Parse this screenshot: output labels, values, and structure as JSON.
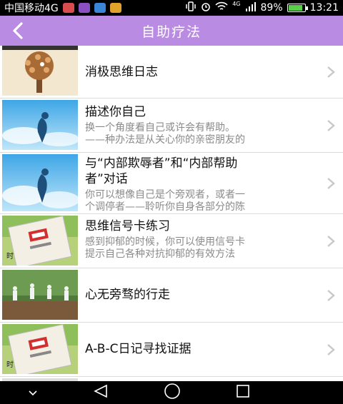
{
  "status_bar": {
    "carrier": "中国移动4G",
    "network_small": "4G",
    "battery_percent": "89%",
    "battery_level": 0.89,
    "time": "13:21"
  },
  "header": {
    "title": "自助疗法",
    "color": "#b98be3"
  },
  "list": [
    {
      "title": "消极思维日志",
      "desc1": "",
      "desc2": "",
      "image": "tree"
    },
    {
      "title": "描述你自己",
      "desc1": "换一个角度看自己或许会有帮助。",
      "desc2": "——种办法是从关心你的亲密朋友的",
      "image": "sky"
    },
    {
      "title": "与“内部欺辱者”和“内部帮助",
      "title2": "者”对话",
      "desc1": "你可以想像自己是个旁观者，或者一",
      "desc2": "个调停者——聆听你自身各部分的陈",
      "image": "sky"
    },
    {
      "title": "思维信号卡练习",
      "desc1": "感到抑郁的时候，你可以使用信号卡",
      "desc2": "提示自己各种对抗抑郁的有效方法",
      "image": "book"
    },
    {
      "title": "心无旁骛的行走",
      "desc1": "",
      "desc2": "",
      "image": "people"
    },
    {
      "title": "A-B-C日记寻找证据",
      "desc1": "",
      "desc2": "",
      "image": "book"
    }
  ]
}
